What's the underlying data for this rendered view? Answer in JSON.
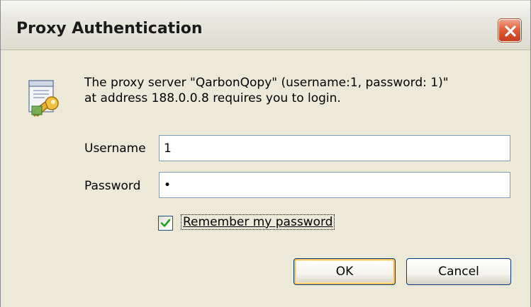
{
  "dialog": {
    "title": "Proxy Authentication",
    "close_label": "Close"
  },
  "message": {
    "line1": "The proxy server \"QarbonQopy\" (username:1, password: 1)\"",
    "line2": "at address 188.0.0.8 requires you to login."
  },
  "form": {
    "username_label": "Username",
    "username_value": "1",
    "password_label": "Password",
    "password_value": "1",
    "remember_label": "Remember my password",
    "remember_checked": true
  },
  "buttons": {
    "ok_label": "OK",
    "cancel_label": "Cancel"
  },
  "icons": {
    "dialog_icon": "key-document-icon",
    "close": "close-icon",
    "check": "checkmark-icon"
  },
  "colors": {
    "close_button": "#e0603d",
    "dialog_background": "#ece9d8",
    "input_border": "#7f9db9",
    "default_button_glow": "#f6c35f",
    "checkmark": "#21a121"
  }
}
